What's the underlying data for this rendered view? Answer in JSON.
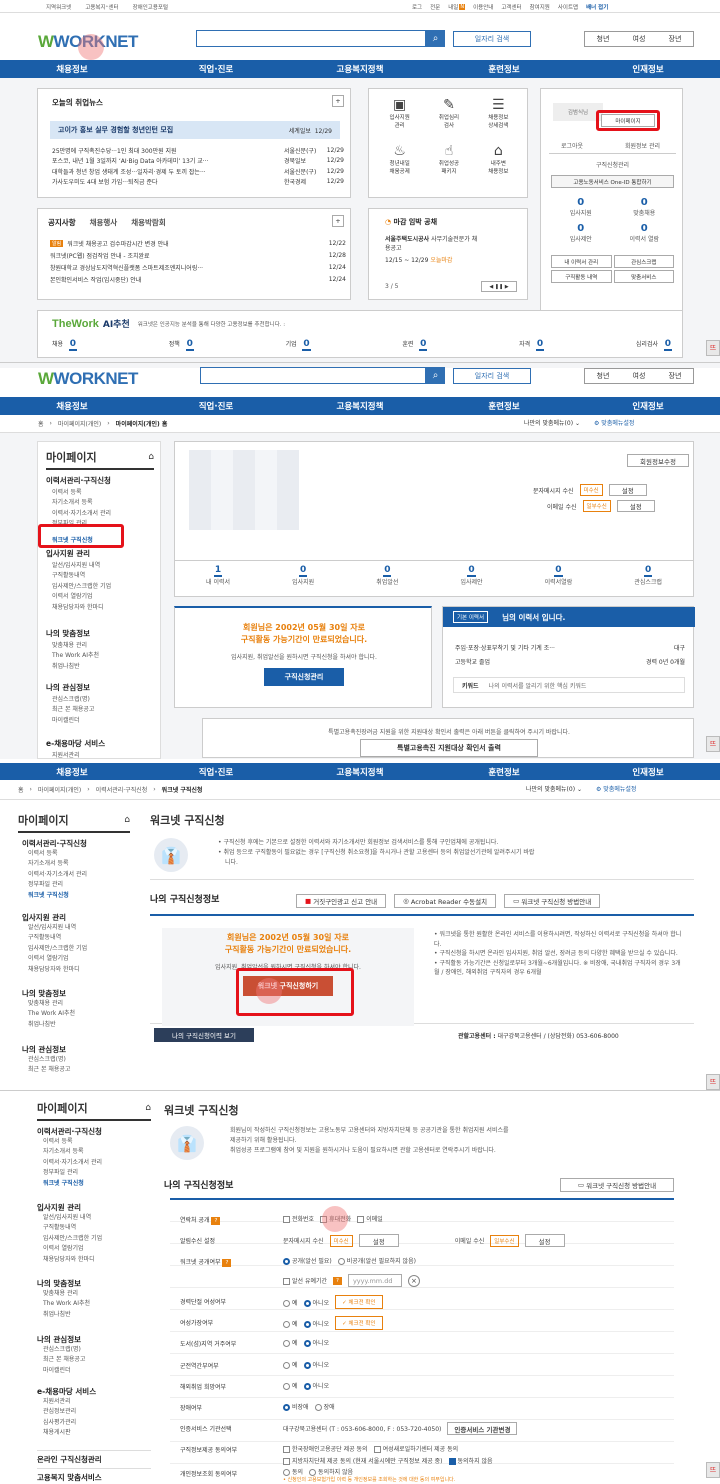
{
  "colors": {
    "navy": "#1a5ea8",
    "red": "#e5121a",
    "orange": "#e8810e",
    "green": "#5aa83a"
  },
  "s1": {
    "util_left": [
      "지역워크넷",
      "고용복지⁺센터",
      "장애인고용포털"
    ],
    "util_right": [
      "로그",
      "전문",
      "내일",
      "이용안내",
      "고객센터",
      "참여지원",
      "사이트맵"
    ],
    "util_badge": "N",
    "util_more": "배너 접기",
    "logo": "WORKNET",
    "search_btn": "일자리 검색",
    "modes": [
      "청년",
      "여성",
      "장년"
    ],
    "nav": [
      "채용정보",
      "직업·진로",
      "고용복지정책",
      "훈련정보",
      "인재정보"
    ],
    "news": {
      "title": "오늘의 취업뉴스",
      "plus": "+",
      "headline": "고이가 홍보 실무 경험할 청년인턴 모집",
      "headline_src": "세계일보",
      "headline_date": "12/29",
      "items": [
        {
          "t": "25만명에 구직촉진수당···1인 최대 300만원 지원",
          "s": "서울신문(구)",
          "d": "12/29"
        },
        {
          "t": "포스코, 내년 1월 3일까지 ‘AI·Big Data 아카데미’ 13기 교···",
          "s": "경북일보",
          "d": "12/29"
        },
        {
          "t": "대학들과 청년 창업 생태계 조성···일자리·경제 두 토끼 잡는···",
          "s": "서울신문(구)",
          "d": "12/29"
        },
        {
          "t": "가사도우미도 4대 보험 가입···퇴직금 준다",
          "s": "한국경제",
          "d": "12/29"
        }
      ]
    },
    "icons": [
      {
        "icon": "resume-icon",
        "l1": "입사지원",
        "l2": "관리"
      },
      {
        "icon": "psych-test-icon",
        "l1": "취업심리",
        "l2": "검사"
      },
      {
        "icon": "job-search-icon",
        "l1": "채용정보",
        "l2": "상세검색"
      },
      {
        "icon": "piggybank-icon",
        "l1": "청년내일",
        "l2": "채움공제"
      },
      {
        "icon": "thumbs-up-icon",
        "l1": "취업성공",
        "l2": "패키지"
      },
      {
        "icon": "near-job-icon",
        "l1": "내주변",
        "l2": "채용정보"
      }
    ],
    "login": {
      "avatar_text": "김범식님",
      "mypage": "마이페이지",
      "logout": "로그아웃",
      "member_manage": "회원정보 관리",
      "apply_manage": "구직신청관리",
      "oneid": "고용노동서비스 One-ID 통합하기",
      "stats": [
        {
          "n": "0",
          "l": "입사지원"
        },
        {
          "n": "0",
          "l": "맞춤채용"
        },
        {
          "n": "0",
          "l": "입사제안"
        },
        {
          "n": "0",
          "l": "이력서 열람"
        }
      ],
      "links": [
        "내 이력서 관리",
        "관심스크랩",
        "구직활동 내역",
        "맞춤서비스"
      ]
    },
    "notice": {
      "tabs": [
        "공지사항",
        "채용행사",
        "채용박람회"
      ],
      "plus": "+",
      "badge": "알림",
      "items": [
        {
          "t": "워크넷 채용공고 검수마감시간 변경 안내",
          "d": "12/22"
        },
        {
          "t": "워크넷(PC웹) 점검작업 안내 - 조치완료",
          "d": "12/28"
        },
        {
          "t": "창원대학교 경상남도지역혁신플랫폼 스마트제조엔지니어링···",
          "d": "12/24"
        },
        {
          "t": "본인확인서비스 작업(임시중단) 안내",
          "d": "12/24"
        }
      ]
    },
    "deadline": {
      "title": "마감 임박 공채",
      "company": "서울주택도시공사",
      "desc": "사무기술전문가 채",
      "desc2": "용공고",
      "period": "12/15 ~ 12/29",
      "today": "오늘마감",
      "page": "3 / 5"
    },
    "thework": {
      "logo": "TheWork",
      "ai": "AI추천",
      "desc": "워크넷은 인공지능 분석을 통해 다양한 고용정보를 추천합니다. :",
      "items": [
        {
          "l": "채용",
          "n": "0"
        },
        {
          "l": "정책",
          "n": "0"
        },
        {
          "l": "기업",
          "n": "0"
        },
        {
          "l": "훈련",
          "n": "0"
        },
        {
          "l": "자격",
          "n": "0"
        },
        {
          "l": "심리검사",
          "n": "0"
        }
      ]
    },
    "float": "뜨"
  },
  "s2": {
    "breadcrumb": [
      "홈",
      "마이페이지(개인)",
      "마이페이지(개인) 홈"
    ],
    "mymenu": "나만의 맞춤메뉴(0)",
    "mymenu_set": "맞춤메뉴설정",
    "sidebar_title": "마이페이지",
    "groups": [
      {
        "h": "이력서관리·구직신청",
        "items": [
          "이력서 등록",
          "자기소개서 등록",
          "이력서·자기소개서 관리",
          "정부파일 관리",
          "워크넷 구직신청"
        ]
      },
      {
        "h": "입사지원 관리",
        "items": [
          "알선/입사지원 내역",
          "구직활동내역",
          "입사제안/스크랩한 기업",
          "이력서 열람기업",
          "채용담당자와 한마디"
        ]
      },
      {
        "h": "나의 맞춤정보",
        "items": [
          "맞춤채용 관리",
          "The Work AI추천",
          "취업나침반"
        ]
      },
      {
        "h": "나의 관심정보",
        "items": [
          "관심스크랩(명)",
          "최근 본 채용공고",
          "마이캘린더"
        ]
      },
      {
        "h": "e-채용마당 서비스",
        "items": [
          "지원서관리"
        ]
      }
    ],
    "member_edit": "회원정보수정",
    "sms": "문자메시지 수신",
    "email": "이메일 수신",
    "unsub": "미수신",
    "partsub": "일부수신",
    "set": "설정",
    "stats": [
      {
        "n": "1",
        "l": "내 이력서"
      },
      {
        "n": "0",
        "l": "입사지원"
      },
      {
        "n": "0",
        "l": "취업알선"
      },
      {
        "n": "0",
        "l": "입사제안"
      },
      {
        "n": "0",
        "l": "이력서열람"
      },
      {
        "n": "0",
        "l": "관심스크랩"
      }
    ],
    "expire1": "회원님은 2002년 05월 30일 자로",
    "expire2": "구직활동 가능기간이 만료되었습니다.",
    "expire_sub": "입사지원, 취업알선을 원하시면 구직신청을 하셔야 합니다.",
    "apply_manage": "구직신청관리",
    "resume_tag": "기본 이력서",
    "resume_title": "님의 이력서 입니다.",
    "resume_job": "주입·포장·상표부착기 및 기타 기계 조···",
    "resume_loc": "대구",
    "resume_edu": "고등학교 졸업",
    "resume_career": "경력 0년 0개월",
    "keyword_label": "키워드",
    "keyword_text": "나의 이력서를 알리기 위한 핵심 키워드",
    "special_note": "특별고용촉진장려금 지원을 위한 지원대상 확인서 출력은 아래 버튼을 클릭하여 주시기 바랍니다.",
    "special_btn": "특별고용촉진 지원대상 확인서 출력"
  },
  "s3": {
    "breadcrumb": [
      "홈",
      "마이페이지(개인)",
      "이력서관리·구직신청",
      "워크넷 구직신청"
    ],
    "title": "워크넷 구직신청",
    "desc1": "구직신청 후에는 기본으로 설정한 이력서와 자기소개서만 회원정보 검색서비스를 통해 구인업체에 공개됩니다.",
    "desc2": "취업 등으로 구직활동이 필요없는 경우 [구직신청 취소요청]을 하시거나 관할 고용센터 등의 취업알선기관에 알려주시기 바랍",
    "desc3": "니다.",
    "sub": "나의 구직신청정보",
    "btn1": "거짓구인광고 신고 안내",
    "btn2": "Acrobat Reader 수동설치",
    "btn3": "워크넷 구직신청 방법안내",
    "expire1": "회원님은 2002년 05월 30일 자로",
    "expire2": "구직활동 가능기간이 만료되었습니다.",
    "expire_sub": "입사지원, 취업알선을 원하시면 구직신청을 하셔야 합니다.",
    "apply_btn": "워크넷 구직신청하기",
    "bullets": [
      "워크넷을 통한 원활한 온라인 서비스를 이용하시려면, 작성하신 이력서로 구직신청을 하셔야 합니다.",
      "구직신청을 하시면 온라인 입사지원, 취업 알선, 장려금 등의 다양한 혜택을 받으실 수 있습니다.",
      "구직활동 가능기간은 신청일로부터 3개월~6개월입니다. ※ 비장애, 국내취업 구직자의 경우 3개월 / 장애인, 해외취업 구직자의 경우 6개월"
    ],
    "history_btn": "나의 구직신청이력 보기",
    "center_label": "관할고용센터 :",
    "center": "대구강북고용센터 / (상담전화) 053-606-8000",
    "sidebar_groups": [
      {
        "h": "이력서관리·구직신청",
        "items": [
          "이력서 등록",
          "자기소개서 등록",
          "이력서·자기소개서 관리",
          "정부파일 관리",
          "워크넷 구직신청"
        ]
      },
      {
        "h": "입사지원 관리",
        "items": [
          "알선/입사지원 내역",
          "구직활동내역",
          "입사제안/스크랩한 기업",
          "이력서 열람기업",
          "채용담당자와 한마디"
        ]
      },
      {
        "h": "나의 맞춤정보",
        "items": [
          "맞춤채용 관리",
          "The Work AI추천",
          "취업나침반"
        ]
      },
      {
        "h": "나의 관심정보",
        "items": [
          "관심스크랩(명)",
          "최근 본 채용공고"
        ]
      }
    ]
  },
  "s4": {
    "title": "워크넷 구직신청",
    "desc1": "회원님이 작성하신 구직신청정보는 고용노동부 고용센터와 지방자치단체 등 공공기관을 통한 취업지원 서비스를",
    "desc2": "제공하기 위해 활용됩니다.",
    "desc3": "취업성공 프로그램에 참여 및 지원을 원하시거나 도움이 필요하시면 관할 고용센터로 연락주시기 바랍니다.",
    "sub": "나의 구직신청정보",
    "guide_btn": "워크넷 구직신청 방법안내",
    "sidebar_groups": [
      {
        "h": "이력서관리·구직신청",
        "items": [
          "이력서 등록",
          "자기소개서 등록",
          "이력서·자기소개서 관리",
          "정부파일 관리",
          "워크넷 구직신청"
        ]
      },
      {
        "h": "입사지원 관리",
        "items": [
          "알선/입사지원 내역",
          "구직활동내역",
          "입사제안/스크랩한 기업",
          "이력서 열람기업",
          "채용담당자와 한마디"
        ]
      },
      {
        "h": "나의 맞춤정보",
        "items": [
          "맞춤채용 관리",
          "The Work AI추천",
          "취업나침반"
        ]
      },
      {
        "h": "나의 관심정보",
        "items": [
          "관심스크랩(명)",
          "최근 본 채용공고",
          "마이캘린더"
        ]
      },
      {
        "h": "e-채용마당 서비스",
        "items": [
          "지원서관리",
          "관심정보관리",
          "심사평가관리",
          "채용게시판"
        ]
      }
    ],
    "extra": [
      "온라인 구직신청관리",
      "고용복지 맞춤서비스"
    ],
    "form": {
      "contact": "연락처 공개",
      "contact_opts": [
        "전화번호",
        "휴대전화",
        "이메일"
      ],
      "notify": "알림수신 설정",
      "sms": "문자메시지 수신",
      "unsub": "미수신",
      "set": "설정",
      "email": "이메일 수신",
      "partsub": "일부수신",
      "open": "워크넷 공개여부",
      "open_opts": [
        "공개(알선 필요)",
        "비공개(알선 필요하지 않음)"
      ],
      "period": "알선 유예기간",
      "date_ph": "yyyy.mm.dd",
      "career_break": "경력단절 여성여부",
      "pregnant": "여성가장여부",
      "island": "도서(섬)지역 거주여부",
      "veteran": "군전역간부여부",
      "overseas": "해외취업 희망여부",
      "disabled": "장애여부",
      "yes": "예",
      "no": "아니오",
      "check_confirm": "체크전 확인",
      "nondis": "비장애",
      "dis": "장애",
      "auth": "인증서비스 기관선택",
      "auth_val": "대구강북고용센터 (T : 053-606-8000, F : 053-720-4050)",
      "auth_btn": "인증서비스 기관변경",
      "consent": "구직정보제공 동의여부",
      "consent1": "한국장애인고용공단 제공 동의",
      "consent2": "여성새로일하기센터 제공 동의",
      "consent3": "지방자치단체 제공 동의 (현재 서울시에만 구직정보 제공 중)",
      "consent4": "동의하지 않음",
      "personal": "개인정보조회 동의여부",
      "agree": "동의",
      "disagree": "동의하지 않음",
      "personal_note": "• 신청인의 고용보험가입 이력 등 개인정보를 조회하는 것에 대한 동의 여부입니다."
    }
  }
}
